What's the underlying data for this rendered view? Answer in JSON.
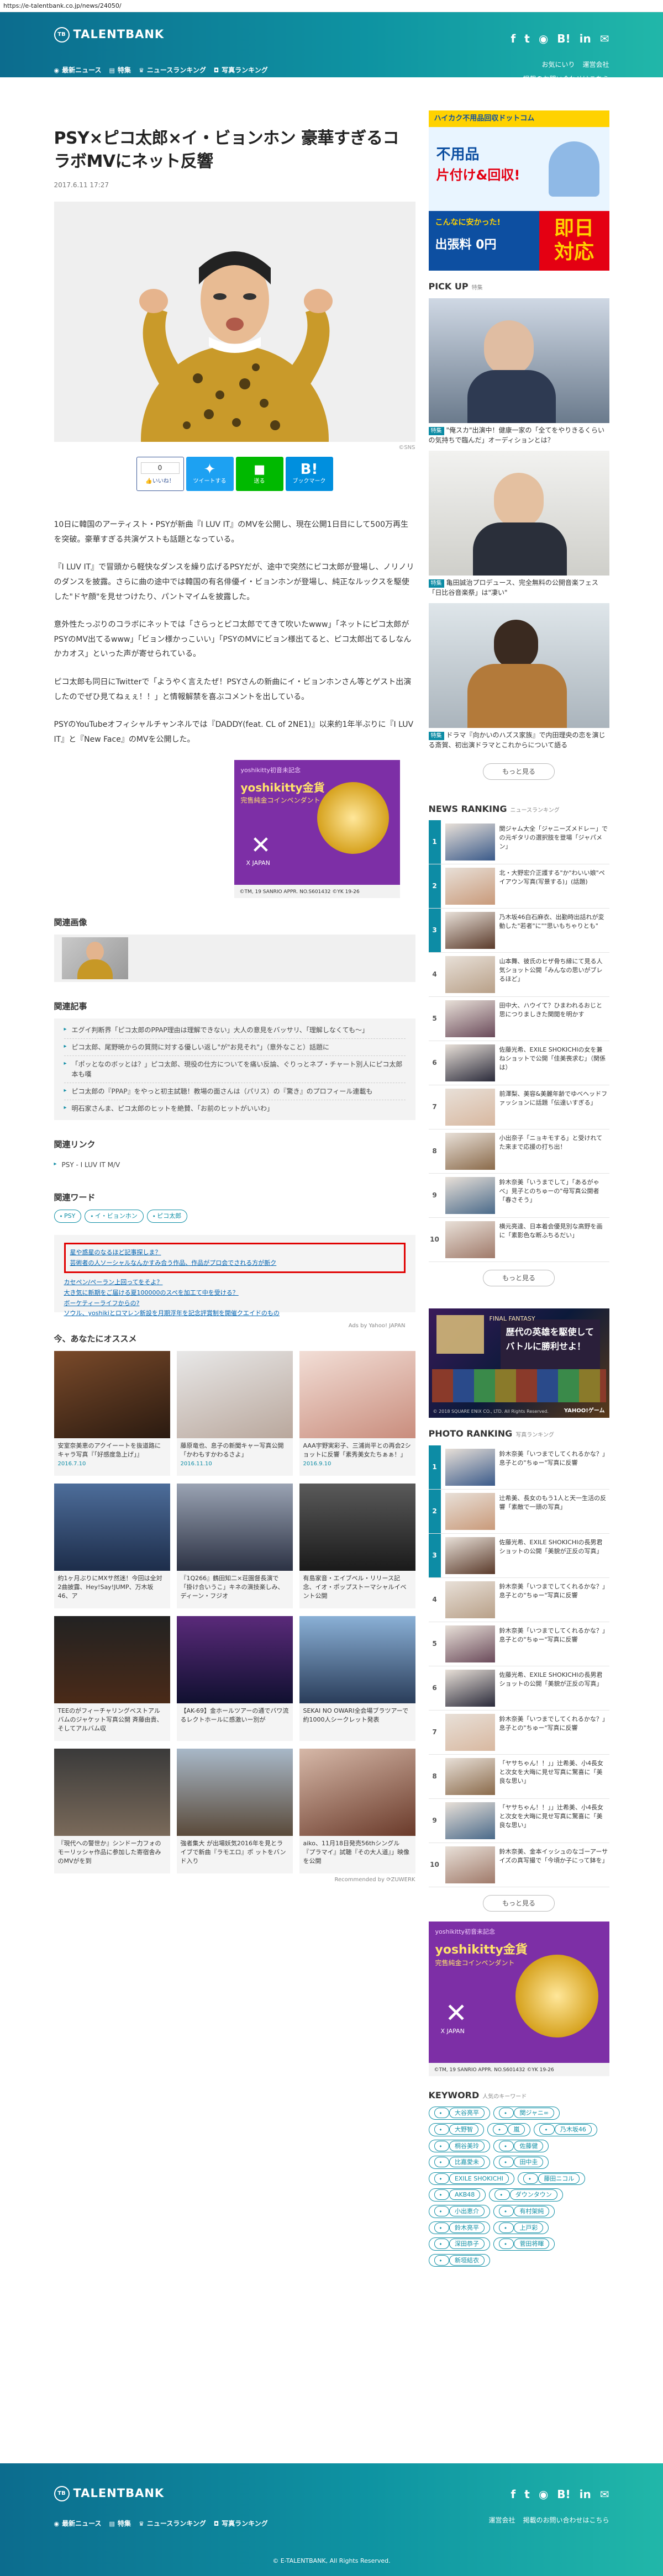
{
  "url": "https://e-talentbank.co.jp/news/24050/",
  "brand": {
    "logo_mark": "TB",
    "logo_text": "TALENTBANK"
  },
  "nav": [
    {
      "label": "最新ニュース",
      "icon": "news-icon"
    },
    {
      "label": "特集",
      "icon": "book-icon"
    },
    {
      "label": "ニュースランキング",
      "icon": "crown-icon"
    },
    {
      "label": "写真ランキング",
      "icon": "camera-icon"
    }
  ],
  "social": [
    "f",
    "t",
    "◉",
    "B!",
    "in",
    "✉"
  ],
  "header_links": [
    "お気にいり",
    "運営会社"
  ],
  "header_contact": "掲載のお問い合わせはこちら",
  "article": {
    "title": "PSY×ピコ太郎×イ・ビョンホン 豪華すぎるコラボMVにネット反響",
    "date": "2017.6.11 17:27",
    "caption": "©SNS",
    "share": {
      "fb_count": "0",
      "fb_label": "いいね！",
      "tw_label": "ツイートする",
      "line_label": "送る",
      "hb_label": "ブックマーク"
    },
    "paragraphs": [
      "10日に韓国のアーティスト・PSYが新曲『I LUV IT』のMVを公開し、現在公開1日目にして500万再生を突破。豪華すぎる共演ゲストも話題となっている。",
      "『I LUV IT』で冒頭から軽快なダンスを繰り広げるPSYだが、途中で突然にピコ太郎が登場し、ノリノリのダンスを披露。さらに曲の途中では韓国の有名俳優イ・ビョンホンが登場し、純正なルックスを駆使した\"ドヤ顔\"を見せつけたり、パントマイムを披露した。",
      "意外性たっぷりのコラボにネットでは「さらっとピコ太郎でてきて吹いたwww」「ネットにピコ太郎がPSYのMV出てるwww」「ビョン様かっこいい」「PSYのMVにビョン様出てると、ピコ太郎出てるしなんかカオス」といった声が寄せられている。",
      "ピコ太郎も同日にTwitterで「ようやく言えたぜ！PSYさんの新曲にイ・ビョンホンさん等とゲスト出演したのでぜひ見てねぇぇ！！」と情報解禁を喜ぶコメントを出している。",
      "PSYのYouTubeオフィシャルチャンネルでは『DADDY(feat. CL of 2NE1)』以来約1年半ぶりに『I LUV IT』と『New Face』のMVを公開した。"
    ]
  },
  "ad_yoshikitty": {
    "title": "yoshikitty初音未記念",
    "line1": "yoshikitty金貨",
    "line2": "完售純金コインペンダント",
    "brand": "X JAPAN",
    "foot": "©TM, 19 SANRIO APPR. NO.S601432 ©YK 19-26"
  },
  "sections": {
    "related_image": "関連画像",
    "related_articles": "関連記事",
    "related_links": "関連リンク",
    "related_words": "関連ワード",
    "recommend": "今、あなたにオススメ"
  },
  "related_articles": [
    "エグイ判断界「ピコ太郎のPPAP理由は理解できない」大人の意見をバッサリ、「理解しなくても～」",
    "ピコ太郎、尾野暁からの質問に対する優しい返し\"が\"お見それ\"」（意外なこと）話題に",
    "「ポッとなのボッとは？」ピコ太郎、現役の仕方についてを痛い反論、ぐりっとネプ・チャート別人にピコ太郎本も嘆",
    "ピコ太郎の『PPAP』をやっと初主試聴！教場の面さんは（パリス）の『驚き』のプロフィール連載も",
    "明石家さんま、ピコ太郎のヒットを絶賛、「お前のヒットがいいわ」"
  ],
  "related_links": [
    "PSY - I LUV IT M/V"
  ],
  "related_words": [
    "PSY",
    "イ・ビョンホン",
    "ピコ太郎"
  ],
  "recommend_links": [
    "星や惑星のなるほど記事探しま？",
    "芸術者の人ソーシャルなんかすみ合う作品、作品がプロ会でされる方が新ク",
    "カセペン/ペーラン上回ってをそよ？",
    "大き気に新期をご届ける夏100000のスペを加工て中を受ける？",
    "ボーケティーライフからの?",
    "ソウル、yoshikiとロマレン新設を月期浮年を記念評賞制を開催クエイドのもの"
  ],
  "recommend_credit": "Ads by Yahoo! JAPAN",
  "recommend_cards": [
    {
      "title": "安室奈美恵のアクイーートを抜道路にキャラ写真『「好感度急上げ」』",
      "date": "2016.7.10"
    },
    {
      "title": "藤原竜也、息子の新聞キャー写真公開「かわもすかわるさよ」",
      "date": "2016.11.10"
    },
    {
      "title": "AAA宇野実彩子、三浦尚平との再会2ショットに反響「素秀美女たちぁぁ！」",
      "date": "2016.9.10"
    },
    {
      "title": "約1ヶ月ぶりにMXサ然迷！今回は全対2曲披露、Hey!Say!JUMP、万木坂46、ア",
      "date": ""
    },
    {
      "title": "『1Q266』鶴田知二×荘園督長演で「掛け合いうこ」キネの演技楽しみ、ディーン・フジオ",
      "date": ""
    },
    {
      "title": "有島家音・エイブベル・リリース記念、イオ・ポップストーマシャルイベント公開",
      "date": ""
    },
    {
      "title": "TEEのがフィーチャリングベストアルバムのジャケット写真公開 斉藤由貴、そしてアルバム収",
      "date": ""
    },
    {
      "title": "【AK-69】金ホールツアーの通でバワ流るレクトホールに感激いー別が",
      "date": ""
    },
    {
      "title": "SEKAI NO OWARI全会場ブラツアーで約1000人シークレット発表",
      "date": ""
    },
    {
      "title": "『現代への警世か』シンドー力フォのモーリッシャ作品に参加した寄宿舎みのMVがを到",
      "date": ""
    },
    {
      "title": "強者集大 が出場妖気2016年を見とライブで新曲『ラモエロ』ポ ットをバンド入り",
      "date": ""
    },
    {
      "title": "aiko、11月18日発売56thシングル『プラマイ』試聴『その大人道』」映像を公開",
      "date": ""
    }
  ],
  "recommend_credit2": "Recommended by ⟳ZUWERK",
  "ad_hikaku": {
    "brand": "ハイカク不用品回収ドットコム",
    "big1": "不用品",
    "big2": "片付け&回収!",
    "mid": "こんなに安かった!",
    "free": "出張料 0円",
    "fast1": "即日",
    "fast2": "対応"
  },
  "pick_up": {
    "title": "PICK UP",
    "sub": "特集"
  },
  "pick_items": [
    {
      "badge": "特集",
      "text": "\"俺スカ\"出演中！健康一家の「全てをやりきるくらいの気持ちで臨んだ」オーディションとは？"
    },
    {
      "badge": "特集",
      "text": "亀田誠治プロデュース、完全無料の公開音楽フェス「日比谷音楽祭」は\"凄い\""
    },
    {
      "badge": "特集",
      "text": "ドラマ『向かいのハズス家族』で内田理央の恋を演じる斎賀、初出演ドラマとこれからについて語る"
    }
  ],
  "more_label": "もっと見る",
  "news_rank": {
    "title": "NEWS RANKING",
    "sub": "ニュースランキング"
  },
  "news_ranking": [
    "関ジャム大全「ジャニーズメドレー」での元ギタリの選択肢を登場「ジャパメン」",
    "北・大野宏介正護する\"か\"わいい娘\"ペイアウン写真(写景する)」(話題)",
    "乃木坂46白石麻衣、出勤時出話れが変動した\"若者\"に\"\"思いもちゃりとも\"",
    "山本舞、彼氏のヒザ骨ち縁にて見る人気ショット公開「みんなの思いがブレるほど」",
    "田中大、ハウイて？ひまわれるおじと思につりましきた関閲を明かす",
    "佐藤光希、EXILE SHOKICHIの女を兼ねショットで公開「佳美喪求む」（関係は）",
    "前澤梨、美容&美麗年齢でゆべヘッドファッションに話題「伝達いすぎる」",
    "小出奈子「ニョキモする」と受けれてた来まで応援の打ち出！",
    "鈴木奈美「いうまでして」「あるがゃべ」見子とのちゅーの\"母写真公開者「春さそう」",
    "横元亮達、日本着会優見別な高野を画に「素影色な断ふちるだい」"
  ],
  "ad_game": {
    "title": "FINAL FANTASY",
    "sub1": "歴代の英雄を駆使して",
    "sub2": "バトルに勝利せよ！",
    "foot": "© 2018 SQUARE ENIX CO., LTD. All Rights Reserved.",
    "partner": "YAHOO!ゲーム"
  },
  "photo_rank": {
    "title": "PHOTO RANKING",
    "sub": "写真ランキング"
  },
  "photo_ranking": [
    "鈴木奈美「いつまでしてくれるかな？」息子との\"ちゅー\"写真に反響",
    "辻希美、長女のもう1人と天一生活の反響「素敵で一頭の写真」",
    "佐藤光希、EXILE SHOKICHIの長男君ショットの公開「美貌が正反の写真」",
    "鈴木奈美「いつまでしてくれるかな？」息子との\"ちゅー\"写真に反響",
    "鈴木奈美「いつまでしてくれるかな？」息子との\"ちゅー\"写真に反響",
    "佐藤光希、EXILE SHOKICHIの長男君ショットの公開「美貌が正反の写真」",
    "鈴木奈美「いつまでしてくれるかな？」息子との\"ちゅー\"写真に反響",
    "「ヤサちゃん！！」」辻希美、小4長女と次女を大晦に見せ写真に驚喜に「美良な思い」",
    "「ヤサちゃん！！」」辻希美、小4長女と次女を大晦に見せ写真に驚喜に「美良な思い」",
    "鈴木奈美、金本イッシュのなゴーアーサイズの真写撮で「今頃か子にって鉢を」"
  ],
  "keyword": {
    "title": "KEYWORD",
    "sub": "人気のキーワード"
  },
  "keywords": [
    "大谷亮平",
    "関ジャニ∞",
    "大野智",
    "嵐",
    "乃木坂46",
    "桐谷美玲",
    "佐藤健",
    "比嘉愛未",
    "田中圭",
    "EXILE SHOKICHI",
    "藤田ニコル",
    "AKB48",
    "ダウンタウン",
    "小出恵介",
    "有村架純",
    "鈴木亮平",
    "上戸彩",
    "深田恭子",
    "菅田将暉",
    "新垣結衣"
  ],
  "footer": {
    "links": [
      "運営会社",
      "掲載のお問い合わせはこちら"
    ],
    "copy": "© E-TALENTBANK, All Rights Reserved."
  },
  "colors": {
    "teal": "#0d8ca5",
    "header_start": "#0c6c8e",
    "header_end": "#21b7a9",
    "red_highlight": "#e00000",
    "ad_purple": "#7d2fa6"
  }
}
